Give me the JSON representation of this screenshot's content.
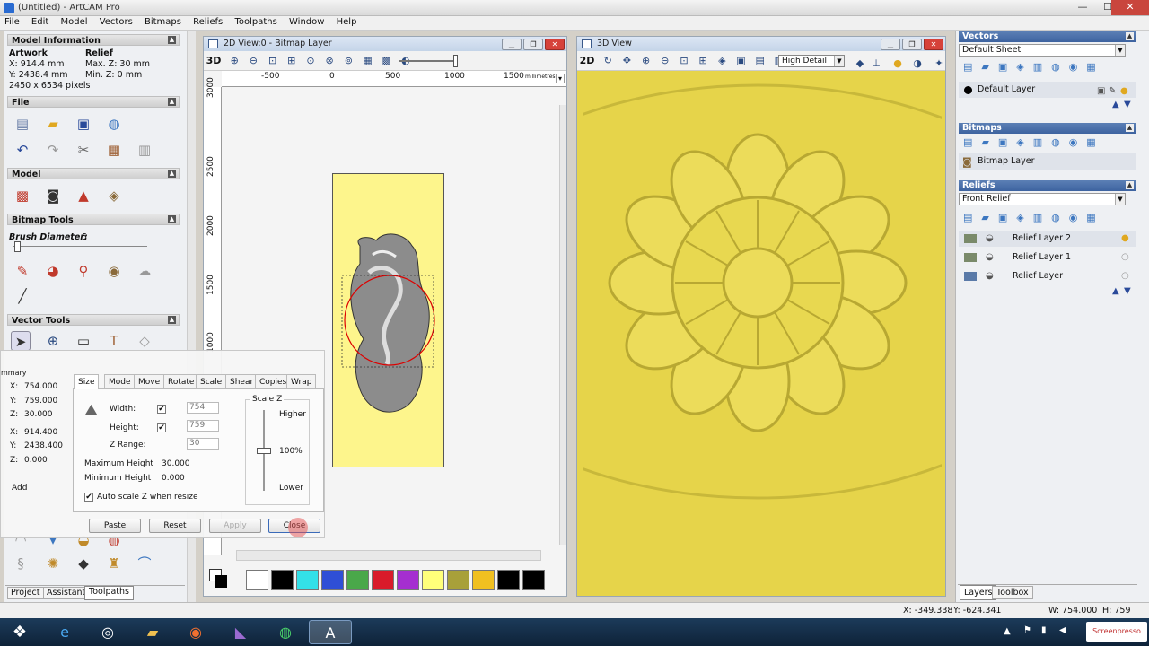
{
  "app": {
    "title": "(Untitled) - ArtCAM Pro",
    "min": "—",
    "max": "☐",
    "close": "✕"
  },
  "menu": [
    "File",
    "Edit",
    "Model",
    "Vectors",
    "Bitmaps",
    "Reliefs",
    "Toolpaths",
    "Window",
    "Help"
  ],
  "model_info": {
    "header": "Model Information",
    "artwork_label": "Artwork",
    "relief_label": "Relief",
    "x": "X: 914.4 mm",
    "y": "Y: 2438.4 mm",
    "pixels": "2450 x 6534 pixels",
    "maxz": "Max. Z: 30 mm",
    "minz": "Min. Z: 0 mm"
  },
  "sections": {
    "file": "File",
    "model": "Model",
    "bitmap_tools": "Bitmap Tools",
    "vector_tools": "Vector Tools"
  },
  "brush": {
    "label": "Brush Diameter:",
    "value": "5"
  },
  "view2d": {
    "title": "2D View:0 - Bitmap Layer",
    "mode": "3D",
    "units": "millimetres",
    "ruler_x": [
      "-500",
      "0",
      "500",
      "1000",
      "1500"
    ],
    "ruler_y": [
      "3000",
      "2500",
      "2000",
      "1500",
      "1000"
    ]
  },
  "view3d": {
    "title": "3D View",
    "mode": "2D",
    "detail": "High Detail"
  },
  "vectors": {
    "header": "Vectors",
    "sheet": "Default Sheet",
    "layer": "Default Layer"
  },
  "bitmaps": {
    "header": "Bitmaps",
    "layer": "Bitmap Layer"
  },
  "reliefs": {
    "header": "Reliefs",
    "selected": "Front Relief",
    "layers": [
      "Relief Layer 2",
      "Relief Layer 1",
      "Relief Layer"
    ]
  },
  "right_tabs": [
    "Layers",
    "Toolbox"
  ],
  "left_tabs": [
    "Project",
    "Assistant",
    "Toolpaths"
  ],
  "summary": {
    "title": "mmary",
    "x": "754.000",
    "y": "759.000",
    "z": "30.000",
    "x2": "914.400",
    "y2": "2438.400",
    "z2": "0.000",
    "add": "Add"
  },
  "dialog": {
    "tabs": [
      "Size",
      "Mode",
      "Move",
      "Rotate",
      "Scale",
      "Shear",
      "Copies",
      "Wrap"
    ],
    "width_label": "Width:",
    "width": "754",
    "height_label": "Height:",
    "height": "759",
    "zrange_label": "Z Range:",
    "zrange": "30",
    "maxh_label": "Maximum Height",
    "maxh": "30.000",
    "minh_label": "Minimum Height",
    "minh": "0.000",
    "autoscale": "Auto scale Z when resize",
    "scalez": "Scale Z",
    "higher": "Higher",
    "percent": "100%",
    "lower": "Lower",
    "paste": "Paste",
    "reset": "Reset",
    "apply": "Apply",
    "close": "Close"
  },
  "palette": [
    "#ffffff",
    "#000000",
    "#33e0e8",
    "#2f4fd6",
    "#4aa84a",
    "#d91b2a",
    "#a52ed0",
    "#ffff7a",
    "#a8a03a",
    "#f0c020",
    "#000000",
    "#000000"
  ],
  "status": {
    "x": "X: -349.338",
    "y": "Y: -624.341",
    "w": "W: 754.000",
    "h": "H: 759"
  },
  "colors": {
    "relief": "#e6d44a",
    "bitmap": "#fdf58c",
    "panel_header": "#4a6fa8"
  }
}
